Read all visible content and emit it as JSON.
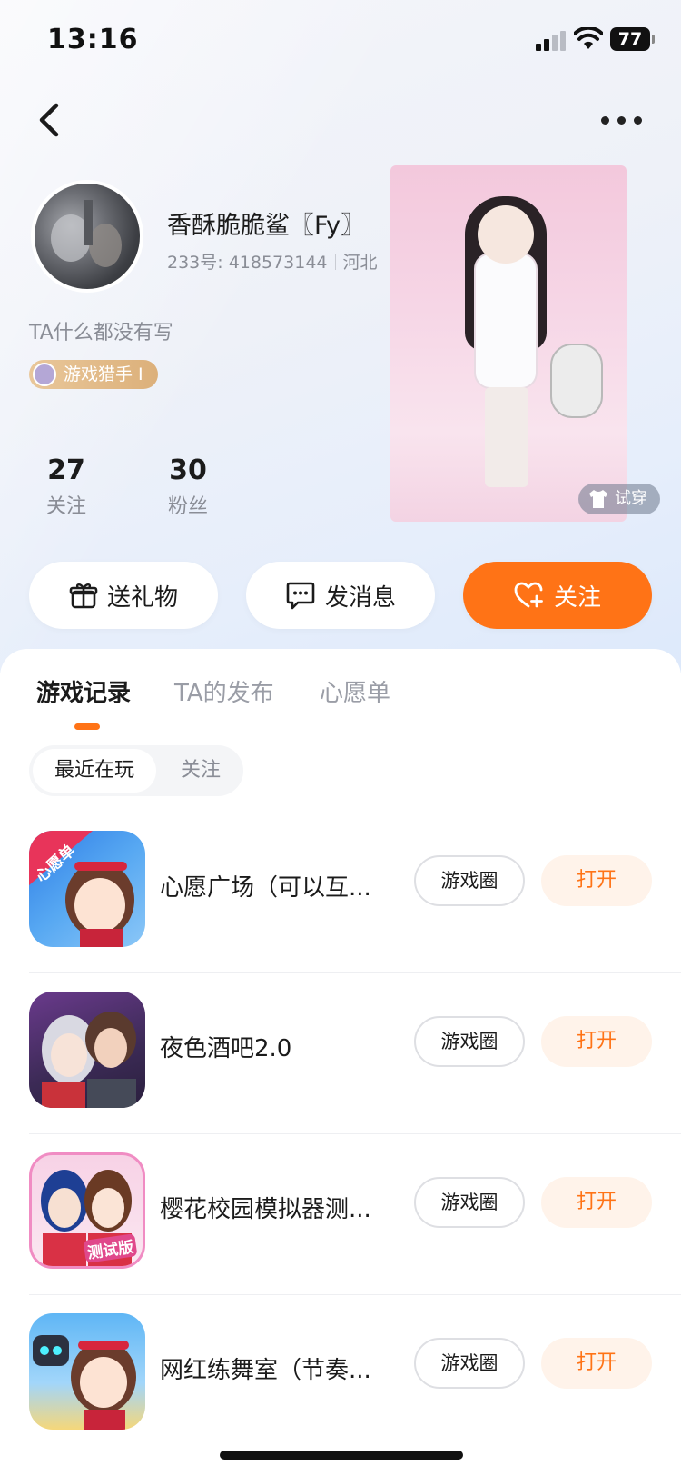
{
  "status_bar": {
    "time": "13:16",
    "battery": "77"
  },
  "profile": {
    "nickname": "香酥脆脆鲨〖Fy〗",
    "uid_label": "233号: 418573144",
    "location": "河北",
    "bio": "TA什么都没有写",
    "badge": "游戏猎手 Ⅰ",
    "stats": [
      {
        "value": "27",
        "label": "关注"
      },
      {
        "value": "30",
        "label": "粉丝"
      }
    ],
    "tryon_label": "试穿"
  },
  "actions": {
    "gift": "送礼物",
    "message": "发消息",
    "follow": "关注"
  },
  "tabs": [
    {
      "label": "游戏记录",
      "active": true
    },
    {
      "label": "TA的发布",
      "active": false
    },
    {
      "label": "心愿单",
      "active": false
    }
  ],
  "segment": {
    "recent": "最近在玩",
    "follow": "关注"
  },
  "games": [
    {
      "title": "心愿广场（可以互...",
      "circle_label": "游戏圈",
      "open_label": "打开",
      "icon_label": "心愿单"
    },
    {
      "title": "夜色酒吧2.0",
      "circle_label": "游戏圈",
      "open_label": "打开"
    },
    {
      "title": "樱花校园模拟器测...",
      "circle_label": "游戏圈",
      "open_label": "打开",
      "icon_label": "测试版"
    },
    {
      "title": "网红练舞室（节奏...",
      "circle_label": "游戏圈",
      "open_label": "打开"
    }
  ],
  "colors": {
    "accent": "#ff7316",
    "open_bg": "#fff3ea",
    "muted_text": "#8a8d96"
  }
}
